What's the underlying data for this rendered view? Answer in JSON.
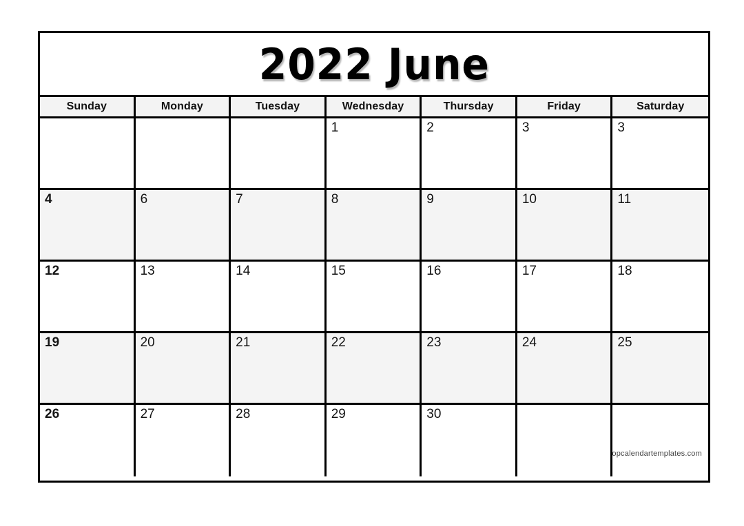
{
  "calendar": {
    "title": "2022 June",
    "year": "2022",
    "month": "June",
    "weekday_headers": [
      "Sunday",
      "Monday",
      "Tuesday",
      "Wednesday",
      "Thursday",
      "Friday",
      "Saturday"
    ],
    "weeks": [
      {
        "shaded": false,
        "days": [
          "",
          "",
          "",
          "1",
          "2",
          "3",
          "3"
        ]
      },
      {
        "shaded": true,
        "days": [
          "4",
          "6",
          "7",
          "8",
          "9",
          "10",
          "11"
        ]
      },
      {
        "shaded": false,
        "days": [
          "12",
          "13",
          "14",
          "15",
          "16",
          "17",
          "18"
        ]
      },
      {
        "shaded": true,
        "days": [
          "19",
          "20",
          "21",
          "22",
          "23",
          "24",
          "25"
        ]
      },
      {
        "shaded": false,
        "days": [
          "26",
          "27",
          "28",
          "29",
          "30",
          "",
          ""
        ]
      }
    ],
    "watermark": "topcalendartemplates.com",
    "colors": {
      "border": "#000000",
      "header_background": "#f3f3f3",
      "shaded_row_background": "#f4f4f4",
      "plain_row_background": "#ffffff",
      "text": "#111111",
      "page_background": "#ffffff"
    }
  }
}
